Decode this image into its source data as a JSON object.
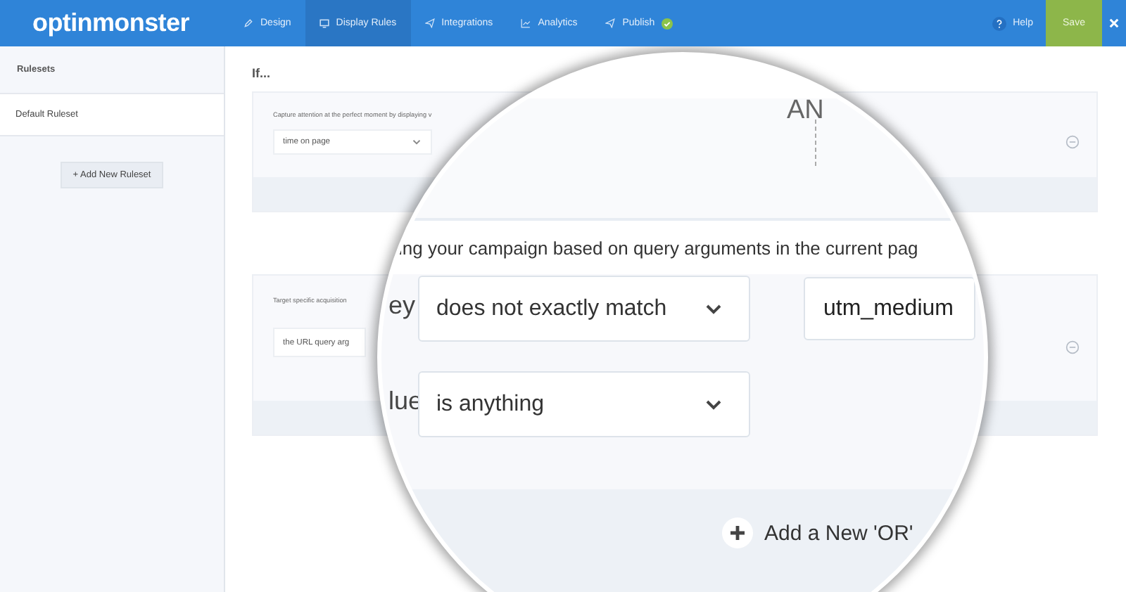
{
  "header": {
    "logo": "optinmonster",
    "nav": [
      {
        "label": "Design",
        "selected": false,
        "done": false
      },
      {
        "label": "Display Rules",
        "selected": true,
        "done": false
      },
      {
        "label": "Integrations",
        "selected": false,
        "done": false
      },
      {
        "label": "Analytics",
        "selected": false,
        "done": false
      },
      {
        "label": "Publish",
        "selected": false,
        "done": true
      }
    ],
    "help": "Help",
    "save": "Save"
  },
  "sidebar": {
    "title": "Rulesets",
    "rulesets": [
      {
        "label": "Default Ruleset",
        "selected": true
      }
    ],
    "add_button": "+ Add New Ruleset"
  },
  "main": {
    "heading": "If...",
    "rules": [
      {
        "description": "Capture attention at the perfect moment by displaying v",
        "select": "time on page"
      },
      {
        "description": "Target specific acquisition",
        "select": "the URL query arg"
      }
    ]
  },
  "magnifier": {
    "and_label": "AN",
    "description": "ing your campaign based on query arguments in the current pag",
    "rows": [
      {
        "label": "ey",
        "operator": "does not exactly match",
        "value": "utm_medium"
      },
      {
        "label": "lue",
        "operator": "is anything"
      }
    ],
    "add_button": "Add a New 'OR'"
  }
}
